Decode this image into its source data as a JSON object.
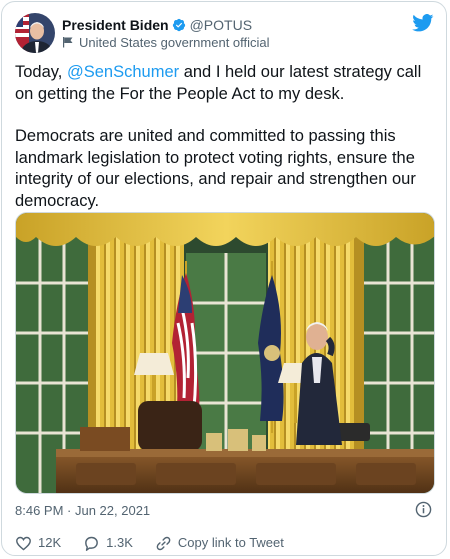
{
  "author": {
    "name": "President Biden",
    "handle": "@POTUS",
    "label": "United States government official"
  },
  "tweet": {
    "text_before_mention": "Today, ",
    "mention": "@SenSchumer",
    "text_after_mention": " and I held our latest strategy call on getting the For the People Act to my desk.",
    "paragraph2": "Democrats are united and committed to passing this landmark legislation to protect voting rights, ensure the integrity of our elections, and repair and strengthen our democracy."
  },
  "meta": {
    "time": "8:46 PM",
    "separator": " · ",
    "date": "Jun 22, 2021"
  },
  "actions": {
    "likes": "12K",
    "replies": "1.3K",
    "copy_link": "Copy link to Tweet"
  },
  "icons": {
    "verified": "verified-badge-icon",
    "label": "flag-icon",
    "brand": "twitter-bird-icon",
    "info": "info-icon",
    "like": "heart-icon",
    "reply": "reply-bubble-icon",
    "link": "link-icon"
  },
  "colors": {
    "accent": "#1d9bf0",
    "text": "#0f1419",
    "secondary": "#536471",
    "border": "#cfd9de"
  }
}
